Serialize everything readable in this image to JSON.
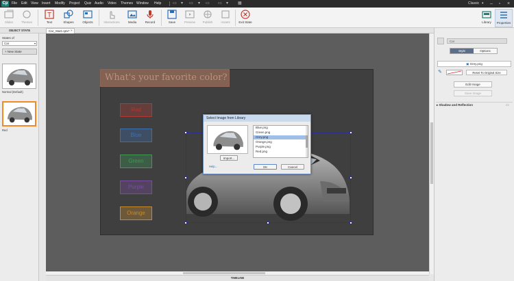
{
  "app": {
    "logo": "Cp",
    "workspace": "Classic"
  },
  "menu": [
    "File",
    "Edit",
    "View",
    "Insert",
    "Modify",
    "Project",
    "Quiz",
    "Audio",
    "Video",
    "Themes",
    "Window",
    "Help"
  ],
  "toolbar": {
    "slides": "Slides",
    "themes": "Themes",
    "text": "Text",
    "shapes": "Shapes",
    "objects": "Objects",
    "interactions": "Interactions",
    "media": "Media",
    "record": "Record",
    "save": "Save",
    "preview": "Preview",
    "publish": "Publish",
    "assets": "Assets",
    "exit_state": "Exit State",
    "library": "Library",
    "properties": "Properties"
  },
  "left_panel": {
    "title": "OBJECT STATE",
    "states_of": "States of",
    "object": "Car",
    "new_state": "New State",
    "states": [
      {
        "label": "Normal (Default)"
      },
      {
        "label": "Red"
      }
    ]
  },
  "document_tab": "Car_Start.cptx*",
  "slide": {
    "title": "What's your favorite color?",
    "buttons": [
      {
        "label": "Red",
        "color": "#b2382f"
      },
      {
        "label": "Blue",
        "color": "#3d6fb0"
      },
      {
        "label": "Green",
        "color": "#3d9a55"
      },
      {
        "label": "Purple",
        "color": "#7b4ca3"
      },
      {
        "label": "Orange",
        "color": "#c98b2f"
      }
    ]
  },
  "dialog": {
    "title": "Select Image from Library",
    "import": "Import...",
    "help": "Help...",
    "ok": "OK",
    "cancel": "Cancel",
    "items": [
      "Blue.png",
      "Green.png",
      "Grey.png",
      "Orange.png",
      "Purple.png",
      "Red.png"
    ],
    "selected": "Grey.png"
  },
  "right_panel": {
    "tab_properties": "PROPERTIES",
    "tab_timing": "TIMING",
    "name": "Car",
    "tab_style": "Style",
    "tab_options": "Options",
    "image": "Grey.png",
    "reset": "Reset To Original Size",
    "edit_image": "Edit Image",
    "save_image": "Save Image",
    "shadow": "Shadow and Reflection"
  },
  "bottom_tab": "TIMELINE"
}
